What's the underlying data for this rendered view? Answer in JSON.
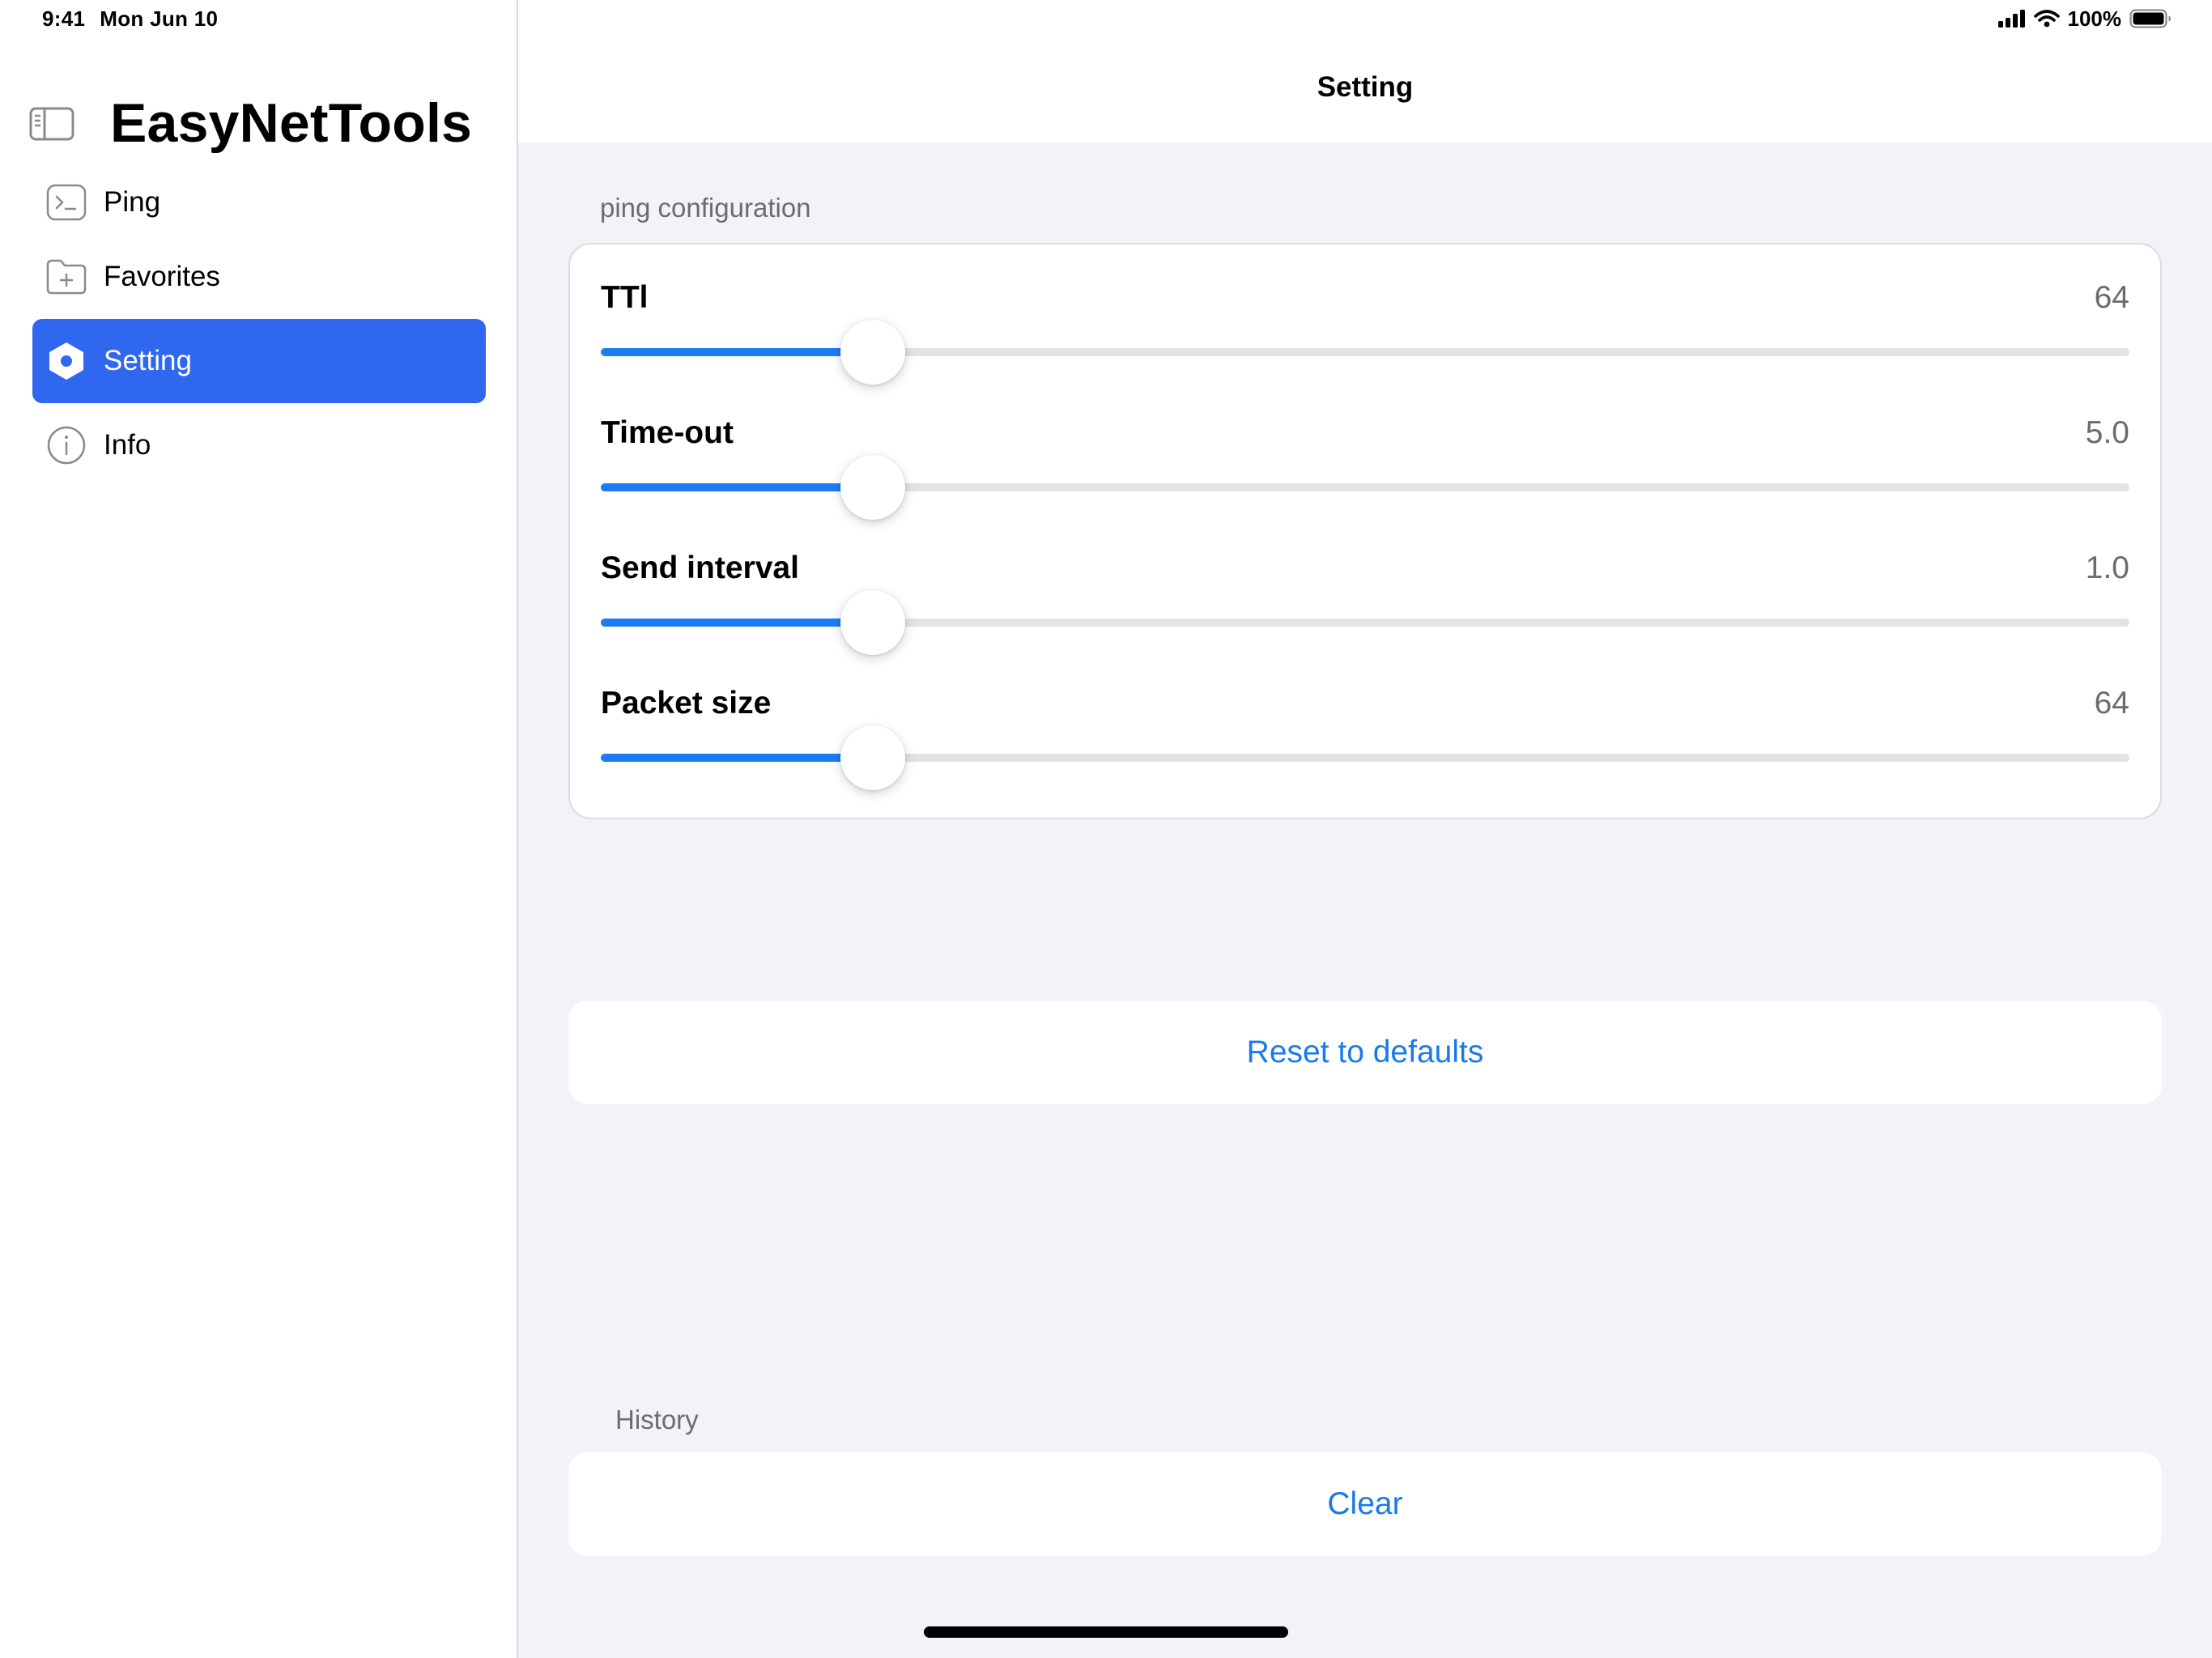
{
  "status_bar": {
    "time": "9:41",
    "date": "Mon Jun 10",
    "battery": "100%"
  },
  "sidebar": {
    "title": "EasyNetTools",
    "items": [
      {
        "label": "Ping",
        "icon": "terminal-icon",
        "active": false
      },
      {
        "label": "Favorites",
        "icon": "folder-plus-icon",
        "active": false
      },
      {
        "label": "Setting",
        "icon": "gear-hexagon-icon",
        "active": true
      },
      {
        "label": "Info",
        "icon": "info-icon",
        "active": false
      }
    ]
  },
  "navbar": {
    "title": "Setting"
  },
  "ping_config": {
    "header": "ping configuration",
    "sliders": [
      {
        "label": "TTl",
        "value": "64",
        "fraction": 0.178
      },
      {
        "label": "Time-out",
        "value": "5.0",
        "fraction": 0.178
      },
      {
        "label": "Send interval",
        "value": "1.0",
        "fraction": 0.178
      },
      {
        "label": "Packet size",
        "value": "64",
        "fraction": 0.178
      }
    ]
  },
  "actions": {
    "reset_label": "Reset to defaults"
  },
  "history": {
    "header": "History",
    "clear_label": "Clear"
  },
  "colors": {
    "accent": "#2f68ee",
    "slider_fill": "#1c7cf4",
    "link": "#1a7ae8",
    "background": "#f2f2f7"
  }
}
